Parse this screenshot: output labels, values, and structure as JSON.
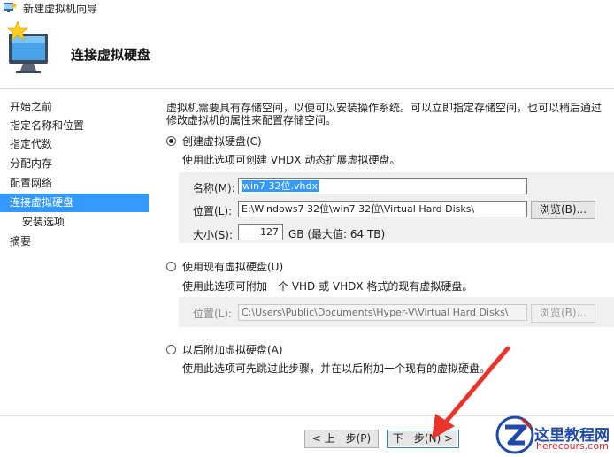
{
  "window": {
    "title": "新建虚拟机向导"
  },
  "header": {
    "title": "连接虚拟硬盘"
  },
  "nav": {
    "items": [
      {
        "label": "开始之前"
      },
      {
        "label": "指定名称和位置"
      },
      {
        "label": "指定代数"
      },
      {
        "label": "分配内存"
      },
      {
        "label": "配置网络"
      },
      {
        "label": "连接虚拟硬盘",
        "active": true
      },
      {
        "label": "安装选项",
        "sub": true
      },
      {
        "label": "摘要"
      }
    ]
  },
  "main": {
    "intro_line1": "虚拟机需要具有存储空间，以便可以安装操作系统。可以立即指定存储空间，也可以稍后通过",
    "intro_line2": "修改虚拟机的属性来配置存储空间。",
    "option_create": {
      "label": "创建虚拟硬盘(C)",
      "selected": true,
      "description": "使用此选项可创建 VHDX 动态扩展虚拟硬盘。",
      "name_label": "名称(M):",
      "name_value": "win7 32位.vhdx",
      "location_label": "位置(L):",
      "location_value": "E:\\Windows7 32位\\win7 32位\\Virtual Hard Disks\\",
      "browse_label": "浏览(B)...",
      "size_label": "大小(S):",
      "size_value": "127",
      "size_unit": "GB (最大值: 64 TB)"
    },
    "option_existing": {
      "label": "使用现有虚拟硬盘(U)",
      "selected": false,
      "description": "使用此选项可附加一个 VHD 或 VHDX 格式的现有虚拟硬盘。",
      "location_label": "位置(L):",
      "location_value": "C:\\Users\\Public\\Documents\\Hyper-V\\Virtual Hard Disks\\",
      "browse_label": "浏览(B)..."
    },
    "option_later": {
      "label": "以后附加虚拟硬盘(A)",
      "selected": false,
      "description": "使用此选项可先跳过此步骤，并在以后附加一个现有的虚拟硬盘。"
    }
  },
  "footer": {
    "prev_label": "< 上一步(P)",
    "next_label": "下一步(N) >"
  },
  "watermark": {
    "name": "这里教程网",
    "url": "herecours.com"
  },
  "colors": {
    "selection": "#3399ff",
    "arrow": "#e8342b",
    "watermark_blue": "#1f4aa8"
  }
}
